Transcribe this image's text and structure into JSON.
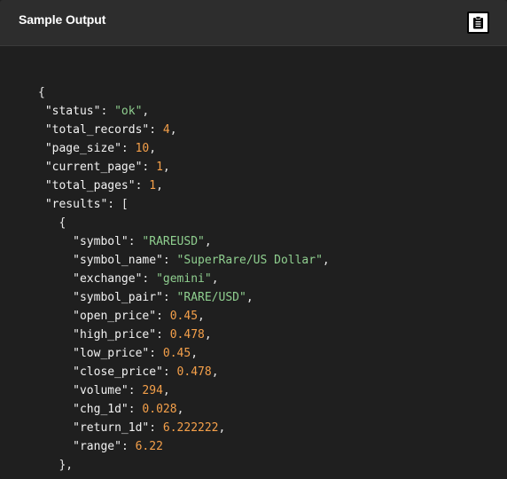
{
  "header": {
    "title": "Sample Output",
    "copy_icon": "clipboard-icon"
  },
  "colors": {
    "background": "#1f1f1f",
    "header": "#2d2d2d",
    "string": "#8fcf8f",
    "number": "#f5a04a",
    "key": "#f2f2f2"
  },
  "code": {
    "lines": [
      {
        "indent": "{",
        "parts": []
      },
      {
        "indent": " ",
        "parts": [
          [
            "key",
            "\"status\""
          ],
          [
            "punc",
            ": "
          ],
          [
            "str",
            "\"ok\""
          ],
          [
            "punc",
            ","
          ]
        ]
      },
      {
        "indent": " ",
        "parts": [
          [
            "key",
            "\"total_records\""
          ],
          [
            "punc",
            ": "
          ],
          [
            "num",
            "4"
          ],
          [
            "punc",
            ","
          ]
        ]
      },
      {
        "indent": " ",
        "parts": [
          [
            "key",
            "\"page_size\""
          ],
          [
            "punc",
            ": "
          ],
          [
            "num",
            "10"
          ],
          [
            "punc",
            ","
          ]
        ]
      },
      {
        "indent": " ",
        "parts": [
          [
            "key",
            "\"current_page\""
          ],
          [
            "punc",
            ": "
          ],
          [
            "num",
            "1"
          ],
          [
            "punc",
            ","
          ]
        ]
      },
      {
        "indent": " ",
        "parts": [
          [
            "key",
            "\"total_pages\""
          ],
          [
            "punc",
            ": "
          ],
          [
            "num",
            "1"
          ],
          [
            "punc",
            ","
          ]
        ]
      },
      {
        "indent": " ",
        "parts": [
          [
            "key",
            "\"results\""
          ],
          [
            "punc",
            ": ["
          ]
        ]
      },
      {
        "indent": "   {",
        "parts": []
      },
      {
        "indent": "     ",
        "parts": [
          [
            "key",
            "\"symbol\""
          ],
          [
            "punc",
            ": "
          ],
          [
            "str",
            "\"RAREUSD\""
          ],
          [
            "punc",
            ","
          ]
        ]
      },
      {
        "indent": "     ",
        "parts": [
          [
            "key",
            "\"symbol_name\""
          ],
          [
            "punc",
            ": "
          ],
          [
            "str",
            "\"SuperRare/US Dollar\""
          ],
          [
            "punc",
            ","
          ]
        ]
      },
      {
        "indent": "     ",
        "parts": [
          [
            "key",
            "\"exchange\""
          ],
          [
            "punc",
            ": "
          ],
          [
            "str",
            "\"gemini\""
          ],
          [
            "punc",
            ","
          ]
        ]
      },
      {
        "indent": "     ",
        "parts": [
          [
            "key",
            "\"symbol_pair\""
          ],
          [
            "punc",
            ": "
          ],
          [
            "str",
            "\"RARE/USD\""
          ],
          [
            "punc",
            ","
          ]
        ]
      },
      {
        "indent": "     ",
        "parts": [
          [
            "key",
            "\"open_price\""
          ],
          [
            "punc",
            ": "
          ],
          [
            "num",
            "0.45"
          ],
          [
            "punc",
            ","
          ]
        ]
      },
      {
        "indent": "     ",
        "parts": [
          [
            "key",
            "\"high_price\""
          ],
          [
            "punc",
            ": "
          ],
          [
            "num",
            "0.478"
          ],
          [
            "punc",
            ","
          ]
        ]
      },
      {
        "indent": "     ",
        "parts": [
          [
            "key",
            "\"low_price\""
          ],
          [
            "punc",
            ": "
          ],
          [
            "num",
            "0.45"
          ],
          [
            "punc",
            ","
          ]
        ]
      },
      {
        "indent": "     ",
        "parts": [
          [
            "key",
            "\"close_price\""
          ],
          [
            "punc",
            ": "
          ],
          [
            "num",
            "0.478"
          ],
          [
            "punc",
            ","
          ]
        ]
      },
      {
        "indent": "     ",
        "parts": [
          [
            "key",
            "\"volume\""
          ],
          [
            "punc",
            ": "
          ],
          [
            "num",
            "294"
          ],
          [
            "punc",
            ","
          ]
        ]
      },
      {
        "indent": "     ",
        "parts": [
          [
            "key",
            "\"chg_1d\""
          ],
          [
            "punc",
            ": "
          ],
          [
            "num",
            "0.028"
          ],
          [
            "punc",
            ","
          ]
        ]
      },
      {
        "indent": "     ",
        "parts": [
          [
            "key",
            "\"return_1d\""
          ],
          [
            "punc",
            ": "
          ],
          [
            "num",
            "6.222222"
          ],
          [
            "punc",
            ","
          ]
        ]
      },
      {
        "indent": "     ",
        "parts": [
          [
            "key",
            "\"range\""
          ],
          [
            "punc",
            ": "
          ],
          [
            "num",
            "6.22"
          ]
        ]
      },
      {
        "indent": "   },",
        "parts": []
      }
    ]
  }
}
